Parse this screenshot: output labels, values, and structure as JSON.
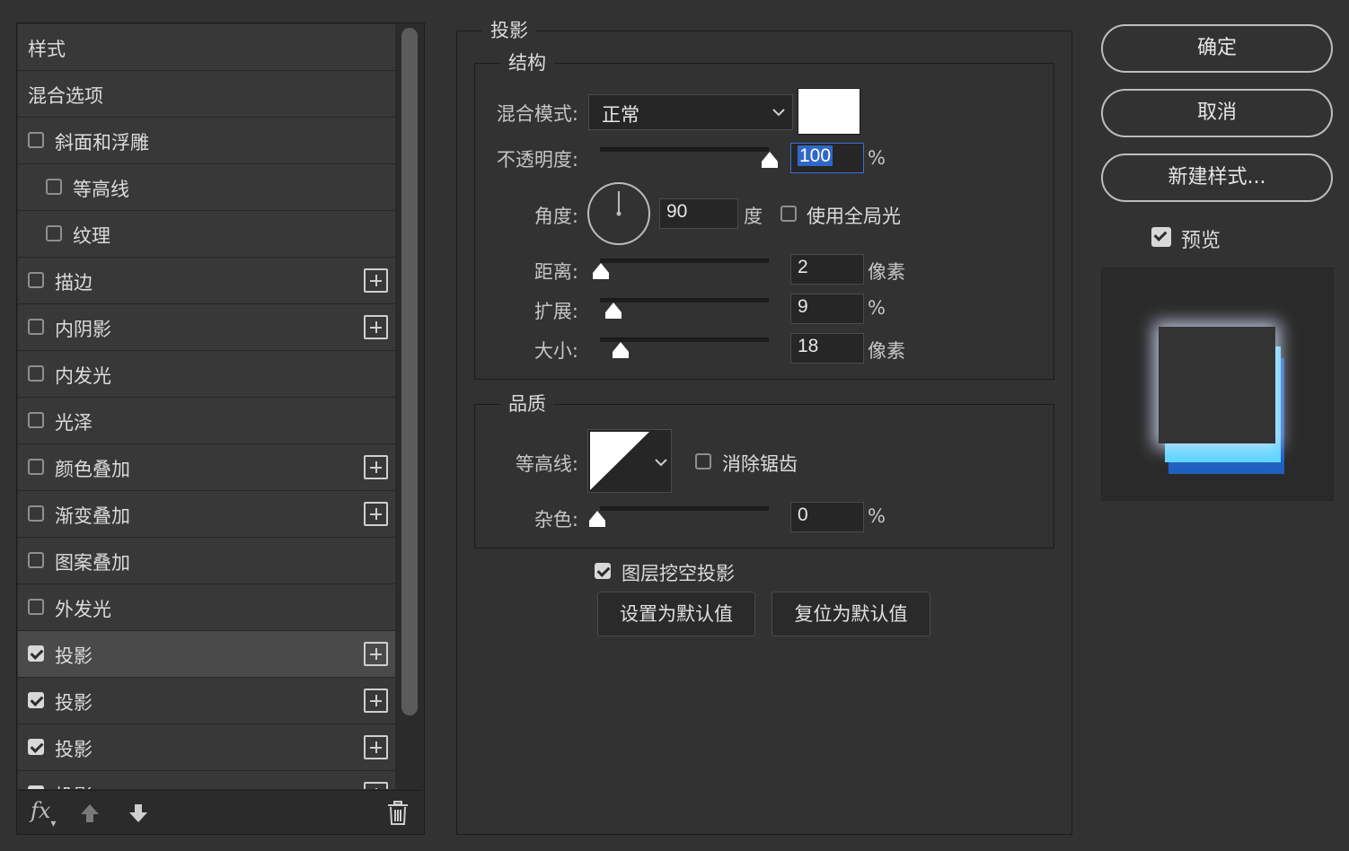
{
  "sidebar": {
    "items": [
      {
        "label": "样式",
        "checkbox": false,
        "checked": false,
        "indent": 0,
        "plus": false,
        "selected": false
      },
      {
        "label": "混合选项",
        "checkbox": false,
        "checked": false,
        "indent": 0,
        "plus": false,
        "selected": false
      },
      {
        "label": "斜面和浮雕",
        "checkbox": true,
        "checked": false,
        "indent": 0,
        "plus": false,
        "selected": false
      },
      {
        "label": "等高线",
        "checkbox": true,
        "checked": false,
        "indent": 1,
        "plus": false,
        "selected": false
      },
      {
        "label": "纹理",
        "checkbox": true,
        "checked": false,
        "indent": 1,
        "plus": false,
        "selected": false
      },
      {
        "label": "描边",
        "checkbox": true,
        "checked": false,
        "indent": 0,
        "plus": true,
        "selected": false
      },
      {
        "label": "内阴影",
        "checkbox": true,
        "checked": false,
        "indent": 0,
        "plus": true,
        "selected": false
      },
      {
        "label": "内发光",
        "checkbox": true,
        "checked": false,
        "indent": 0,
        "plus": false,
        "selected": false
      },
      {
        "label": "光泽",
        "checkbox": true,
        "checked": false,
        "indent": 0,
        "plus": false,
        "selected": false
      },
      {
        "label": "颜色叠加",
        "checkbox": true,
        "checked": false,
        "indent": 0,
        "plus": true,
        "selected": false
      },
      {
        "label": "渐变叠加",
        "checkbox": true,
        "checked": false,
        "indent": 0,
        "plus": true,
        "selected": false
      },
      {
        "label": "图案叠加",
        "checkbox": true,
        "checked": false,
        "indent": 0,
        "plus": false,
        "selected": false
      },
      {
        "label": "外发光",
        "checkbox": true,
        "checked": false,
        "indent": 0,
        "plus": false,
        "selected": false
      },
      {
        "label": "投影",
        "checkbox": true,
        "checked": true,
        "indent": 0,
        "plus": true,
        "selected": true
      },
      {
        "label": "投影",
        "checkbox": true,
        "checked": true,
        "indent": 0,
        "plus": true,
        "selected": false
      },
      {
        "label": "投影",
        "checkbox": true,
        "checked": true,
        "indent": 0,
        "plus": true,
        "selected": false
      },
      {
        "label": "投影",
        "checkbox": true,
        "checked": true,
        "indent": 0,
        "plus": true,
        "selected": false
      }
    ],
    "footer": {
      "fx": "fx",
      "icons": [
        "fx-icon",
        "arrow-up-icon",
        "arrow-down-icon",
        "trash-icon"
      ]
    }
  },
  "main": {
    "section_title": "投影",
    "structure": {
      "title": "结构",
      "blend_mode_label": "混合模式:",
      "blend_mode_value": "正常",
      "shadow_color": "#ffffff",
      "opacity_label": "不透明度:",
      "opacity_value": "100",
      "opacity_unit": "%",
      "opacity_level": 100,
      "angle_label": "角度:",
      "angle_value": "90",
      "angle_unit": "度",
      "global_light_label": "使用全局光",
      "global_light_checked": false,
      "distance_label": "距离:",
      "distance_value": "2",
      "distance_unit": "像素",
      "spread_label": "扩展:",
      "spread_value": "9",
      "spread_unit": "%",
      "size_label": "大小:",
      "size_value": "18",
      "size_unit": "像素"
    },
    "quality": {
      "title": "品质",
      "contour_label": "等高线:",
      "antialias_label": "消除锯齿",
      "antialias_checked": false,
      "noise_label": "杂色:",
      "noise_value": "0",
      "noise_unit": "%"
    },
    "knockout_label": "图层挖空投影",
    "knockout_checked": true,
    "set_default_label": "设置为默认值",
    "reset_default_label": "复位为默认值"
  },
  "actions": {
    "ok_label": "确定",
    "cancel_label": "取消",
    "new_style_label": "新建样式...",
    "preview_label": "预览",
    "preview_checked": true
  },
  "colors": {
    "background": "#323232",
    "preview_shadow": "#5bd5ff",
    "preview_shadow_dark": "#1f5fbf"
  }
}
